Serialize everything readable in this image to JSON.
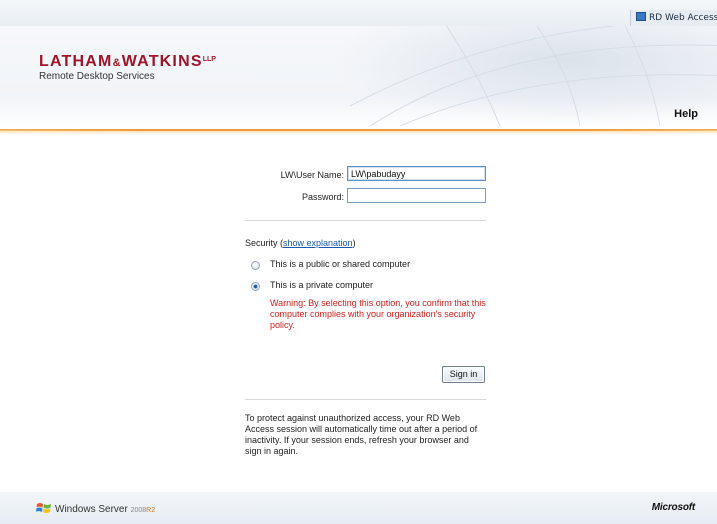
{
  "top_bar": {
    "tab_label": "RD Web Access"
  },
  "header": {
    "logo_main": "LATHAM",
    "logo_amp": "&",
    "logo_main2": "WATKINS",
    "logo_llp": "LLP",
    "logo_sub": "Remote Desktop Services",
    "help_label": "Help"
  },
  "form": {
    "username_label": "LW\\User Name:",
    "username_value": "LW\\pabudayy",
    "password_label": "Password:",
    "password_value": "",
    "security_label": "Security",
    "show_explanation": "show explanation",
    "radio_public_label": "This is a public or shared computer",
    "radio_private_label": "This is a private computer",
    "selected_option": "private",
    "warning_text": "Warning: By selecting this option, you confirm that this computer complies with your organization's security policy.",
    "sign_in_label": "Sign in",
    "notice_text": "To protect against unauthorized access, your RD Web Access session will automatically time out after a period of inactivity. If your session ends, refresh your browser and sign in again."
  },
  "footer": {
    "windows_server_label": "Windows Server",
    "windows_server_version": "2008",
    "windows_server_release": "R2",
    "microsoft_label": "Microsoft"
  },
  "colors": {
    "brand_red": "#a0142a",
    "accent_orange": "#f09a35",
    "warning_red": "#d42020",
    "link_blue": "#1a5aa8"
  }
}
